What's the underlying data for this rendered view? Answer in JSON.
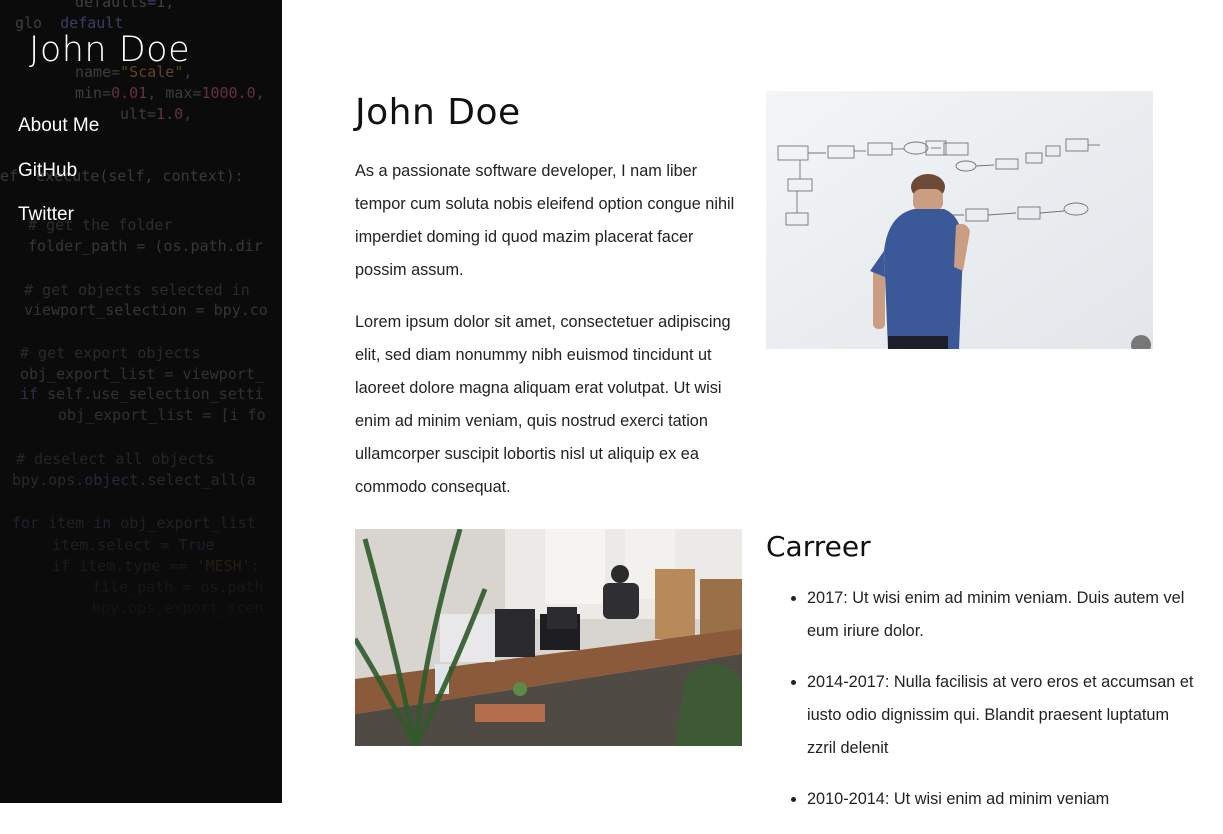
{
  "sidebar": {
    "brand": "John Doe",
    "nav": [
      {
        "label": "About Me"
      },
      {
        "label": "GitHub"
      },
      {
        "label": "Twitter"
      }
    ]
  },
  "main": {
    "title": "John Doe",
    "paragraphs": [
      "As a passionate software developer, I nam liber tempor cum soluta nobis eleifend option congue nihil imperdiet doming id quod mazim placerat facer possim assum.",
      "Lorem ipsum dolor sit amet, consectetuer adipiscing elit, sed diam nonummy nibh euismod tincidunt ut laoreet dolore magna aliquam erat volutpat. Ut wisi enim ad minim veniam, quis nostrud exerci tation ullamcorper suscipit lobortis nisl ut aliquip ex ea commodo consequat."
    ],
    "career": {
      "title": "Carreer",
      "items": [
        "2017: Ut wisi enim ad minim veniam. Duis autem vel eum iriure dolor.",
        "2014-2017: Nulla facilisis at vero eros et accumsan et iusto odio dignissim qui. Blandit praesent luptatum zzril delenit",
        "2010-2014: Ut wisi enim ad minim veniam"
      ]
    }
  },
  "colors": {
    "sidebar_bg": "#0b0b0b",
    "text": "#222222",
    "link": "#ffffff"
  }
}
